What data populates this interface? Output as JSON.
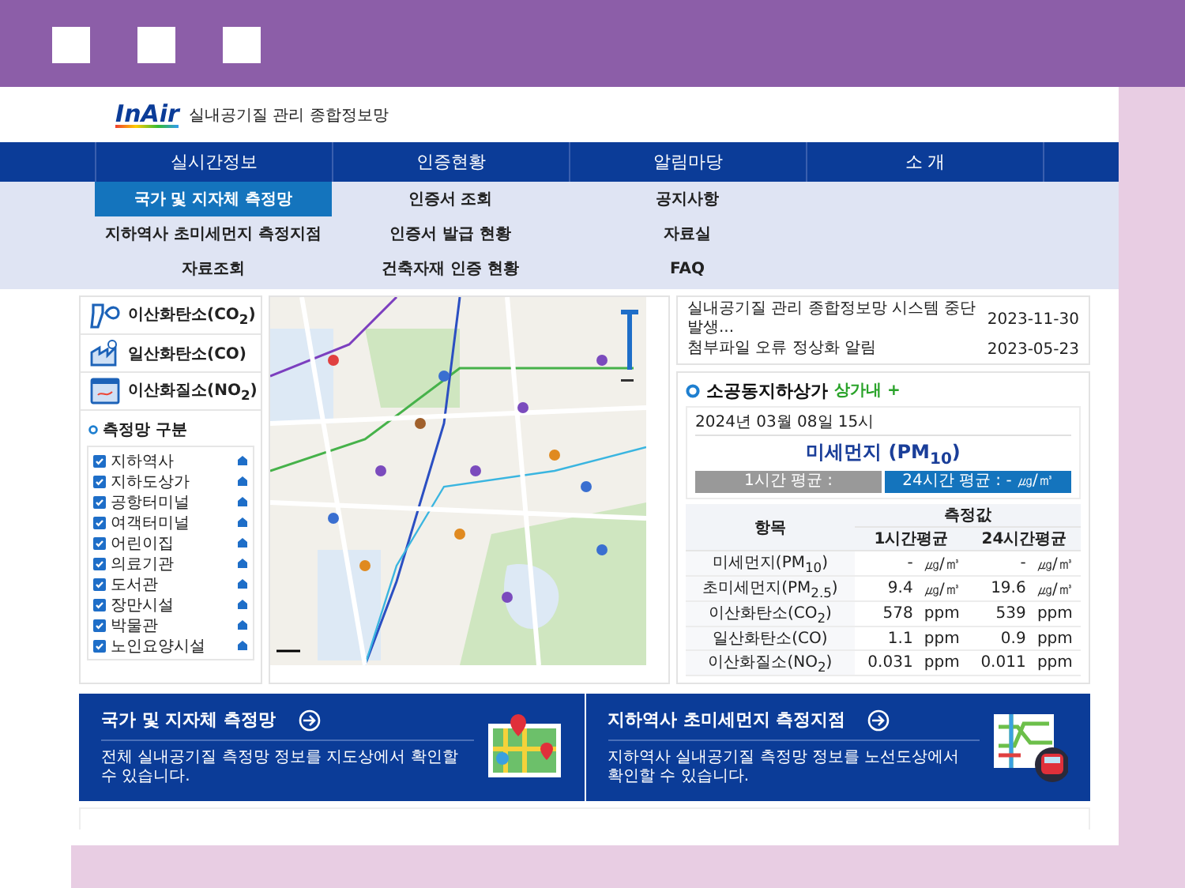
{
  "header": {
    "logo": "InAir",
    "title": "실내공기질 관리 종합정보망"
  },
  "nav": [
    {
      "label": "실시간정보",
      "submenu": [
        {
          "label": "국가 및 지자체 측정망",
          "selected": true
        },
        {
          "label": "지하역사 초미세먼지 측정지점",
          "selected": false
        },
        {
          "label": "자료조회",
          "selected": false
        }
      ]
    },
    {
      "label": "인증현황",
      "submenu": [
        {
          "label": "인증서 조회",
          "selected": false
        },
        {
          "label": "인증서 발급 현황",
          "selected": false
        },
        {
          "label": "건축자재 인증 현황",
          "selected": false
        }
      ]
    },
    {
      "label": "알림마당",
      "submenu": [
        {
          "label": "공지사항",
          "selected": false
        },
        {
          "label": "자료실",
          "selected": false
        },
        {
          "label": "FAQ",
          "selected": false
        }
      ]
    },
    {
      "label": "소 개"
    }
  ],
  "sidebar": {
    "pollutants": [
      {
        "label": "이산화탄소(CO$_{2}$)",
        "kind": "bottle"
      },
      {
        "label": "일산화탄소(CO)",
        "kind": "factory"
      },
      {
        "label": "이산화질소(NO$_{2}$)",
        "kind": "monitor"
      }
    ],
    "filter_title": "측정망 구분",
    "filters": [
      {
        "label": "지하역사",
        "checked": true
      },
      {
        "label": "지하도상가",
        "checked": true
      },
      {
        "label": "공항터미널",
        "checked": true
      },
      {
        "label": "여객터미널",
        "checked": true
      },
      {
        "label": "어린이집",
        "checked": true
      },
      {
        "label": "의료기관",
        "checked": true
      },
      {
        "label": "도서관",
        "checked": true
      },
      {
        "label": "장만시설",
        "checked": true
      },
      {
        "label": "박물관",
        "checked": true
      },
      {
        "label": "노인요양시설",
        "checked": true
      }
    ]
  },
  "notices": [
    {
      "title": "실내공기질 관리 종합정보망 시스템 중단 발생...",
      "date": "2023-11-30"
    },
    {
      "title": "첨부파일 오류 정상화 알림",
      "date": "2023-05-23"
    }
  ],
  "station": {
    "name": "소공동지하상가",
    "location": "상가내 +",
    "timestamp": "2024년 03월 08일 15시",
    "pollutant": "미세먼지 (PM$_{10}$)",
    "averages": [
      {
        "label": "1시간 평균 :",
        "selected": false
      },
      {
        "label": "24시간 평균 : - ㎍/㎥",
        "selected": true
      }
    ],
    "table": {
      "columns": [
        "항목",
        "측정값",
        "1시간평균",
        "24시간평균"
      ],
      "rows": [
        {
          "item": "미세먼지(PM$_{10}$)",
          "hour_value": "-",
          "hour_unit": "㎍/㎥",
          "day_value": "-",
          "day_unit": "㎍/㎥"
        },
        {
          "item": "초미세먼지(PM$_{2.5}$)",
          "hour_value": "9.4",
          "hour_unit": "㎍/㎥",
          "day_value": "19.6",
          "day_unit": "㎍/㎥"
        },
        {
          "item": "이산화탄소(CO$_{2}$)",
          "hour_value": "578",
          "hour_unit": "ppm",
          "day_value": "539",
          "day_unit": "ppm"
        },
        {
          "item": "일산화탄소(CO)",
          "hour_value": "1.1",
          "hour_unit": "ppm",
          "day_value": "0.9",
          "day_unit": "ppm"
        },
        {
          "item": "이산화질소(NO$_{2}$)",
          "hour_value": "0.031",
          "hour_unit": "ppm",
          "day_value": "0.011",
          "day_unit": "ppm"
        }
      ]
    }
  },
  "banners": [
    {
      "kind": "map",
      "title": "국가 및 지자체 측정망",
      "description": "전체 실내공기질 측정망 정보를 지도상에서 확인할 수 있습니다."
    },
    {
      "kind": "subway",
      "title": "지하역사 초미세먼지 측정지점",
      "description": "지하역사 실내공기질 측정망 정보를 노선도상에서 확인할 수 있습니다."
    }
  ]
}
